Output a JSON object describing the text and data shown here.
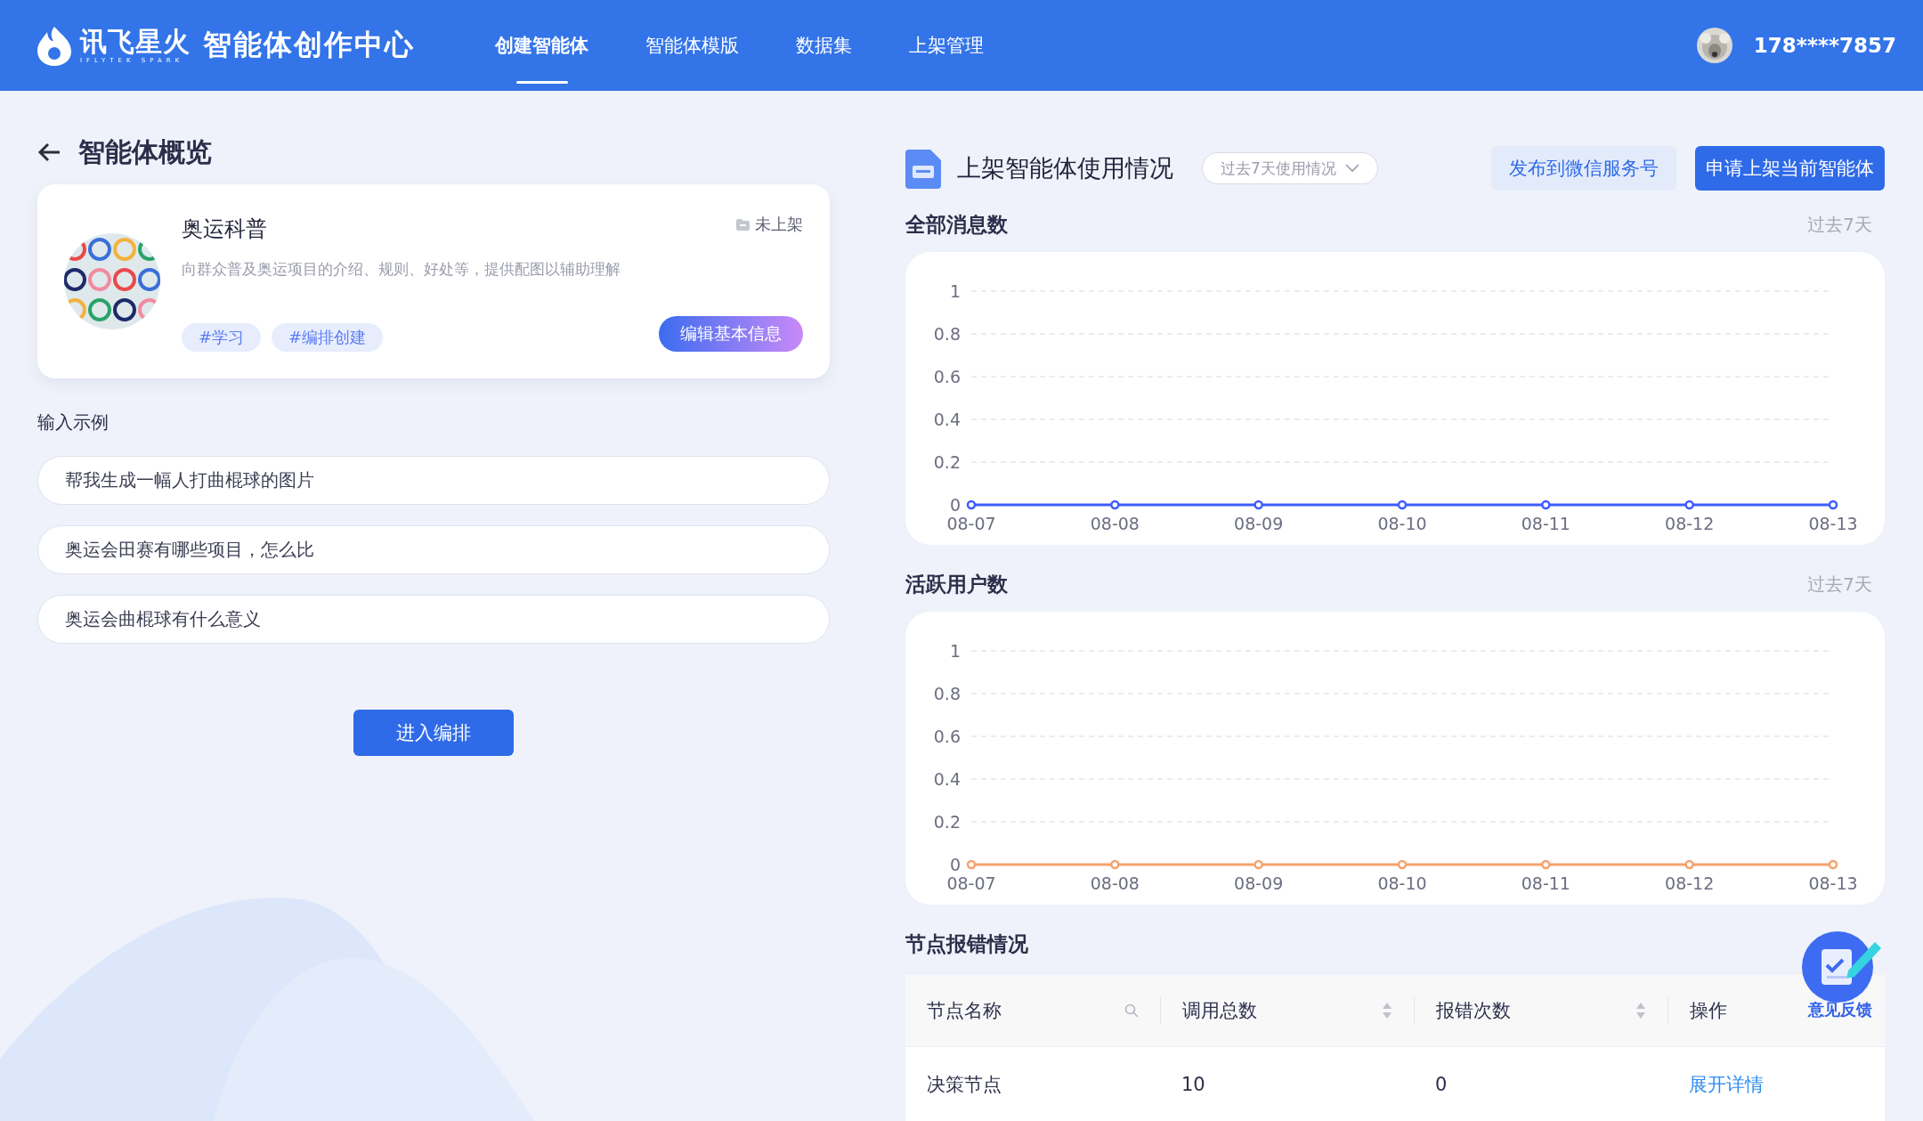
{
  "header": {
    "logo_text": "讯飞星火",
    "logo_subtext": "IFLYTEK SPARK",
    "app_title": "智能体创作中心",
    "nav": [
      {
        "label": "创建智能体",
        "selected": true
      },
      {
        "label": "智能体模版",
        "selected": false
      },
      {
        "label": "数据集",
        "selected": false
      },
      {
        "label": "上架管理",
        "selected": false
      }
    ],
    "user": {
      "phone": "178****7857"
    }
  },
  "overview": {
    "title": "智能体概览",
    "agent": {
      "name": "奥运科普",
      "status": "未上架",
      "description": "向群众普及奥运项目的介绍、规则、好处等，提供配图以辅助理解",
      "tags": [
        "#学习",
        "#编排创建"
      ],
      "edit_button": "编辑基本信息"
    },
    "examples_title": "输入示例",
    "examples": [
      "帮我生成一幅人打曲棍球的图片",
      "奥运会田赛有哪些项目，怎么比",
      "奥运会曲棍球有什么意义"
    ],
    "enter_button": "进入编排"
  },
  "usage": {
    "title": "上架智能体使用情况",
    "period_select": "过去7天使用情况",
    "buttons": [
      {
        "label": "发布到微信服务号",
        "kind": "secondary"
      },
      {
        "label": "申请上架当前智能体",
        "kind": "primary"
      }
    ],
    "charts": [
      {
        "title": "全部消息数",
        "period": "过去7天",
        "chart_data": {
          "type": "line",
          "categories": [
            "08-07",
            "08-08",
            "08-09",
            "08-10",
            "08-11",
            "08-12",
            "08-13"
          ],
          "ylim": [
            0,
            1
          ],
          "yticks": [
            0,
            0.2,
            0.4,
            0.6,
            0.8,
            1
          ],
          "grid": true,
          "series": [
            {
              "color": "#3d5cff",
              "marker": "circle",
              "values": [
                0,
                0,
                0,
                0,
                0,
                0,
                0
              ]
            }
          ]
        }
      },
      {
        "title": "活跃用户数",
        "period": "过去7天",
        "chart_data": {
          "type": "line",
          "categories": [
            "08-07",
            "08-08",
            "08-09",
            "08-10",
            "08-11",
            "08-12",
            "08-13"
          ],
          "ylim": [
            0,
            1
          ],
          "yticks": [
            0,
            0.2,
            0.4,
            0.6,
            0.8,
            1
          ],
          "grid": true,
          "series": [
            {
              "color": "#f5a36b",
              "marker": "circle",
              "values": [
                0,
                0,
                0,
                0,
                0,
                0,
                0
              ]
            }
          ]
        }
      }
    ],
    "errors": {
      "title": "节点报错情况",
      "columns": [
        {
          "label": "节点名称",
          "kind": "search"
        },
        {
          "label": "调用总数",
          "kind": "sort"
        },
        {
          "label": "报错次数",
          "kind": "sort"
        },
        {
          "label": "操作",
          "kind": "plain"
        }
      ],
      "rows": [
        {
          "cells": [
            "决策节点",
            "10",
            "0"
          ],
          "action": "展开详情"
        }
      ]
    }
  },
  "feedback": {
    "label": "意见反馈"
  }
}
